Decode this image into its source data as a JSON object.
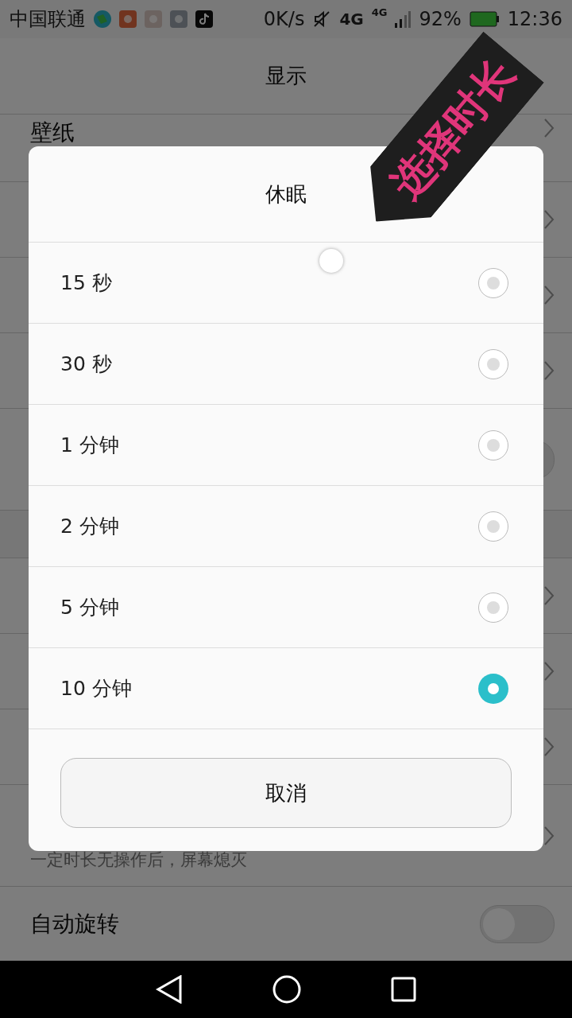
{
  "status_bar": {
    "carrier": "中国联通",
    "speed": "0K/s",
    "network": "4G",
    "network_small": "4G",
    "battery": "92%",
    "time": "12:36"
  },
  "header": {
    "title": "显示"
  },
  "background_rows": [
    {
      "label": "壁纸",
      "kind": "link"
    },
    {
      "kind": "link"
    },
    {
      "kind": "link"
    },
    {
      "kind": "link"
    },
    {
      "kind": "toggle",
      "on": false
    },
    {
      "kind": "section"
    },
    {
      "kind": "link"
    },
    {
      "kind": "link"
    },
    {
      "kind": "link"
    },
    {
      "kind": "hint",
      "hint": "一定时长无操作后，屏幕熄灭"
    },
    {
      "kind": "toggle",
      "label": "自动旋转",
      "on": false
    }
  ],
  "dialog": {
    "title": "休眠",
    "options": [
      {
        "label": "15 秒",
        "selected": false
      },
      {
        "label": "30 秒",
        "selected": false
      },
      {
        "label": "1 分钟",
        "selected": false
      },
      {
        "label": "2 分钟",
        "selected": false
      },
      {
        "label": "5 分钟",
        "selected": false
      },
      {
        "label": "10 分钟",
        "selected": true
      }
    ],
    "cancel": "取消"
  },
  "annotation": "选择时长"
}
